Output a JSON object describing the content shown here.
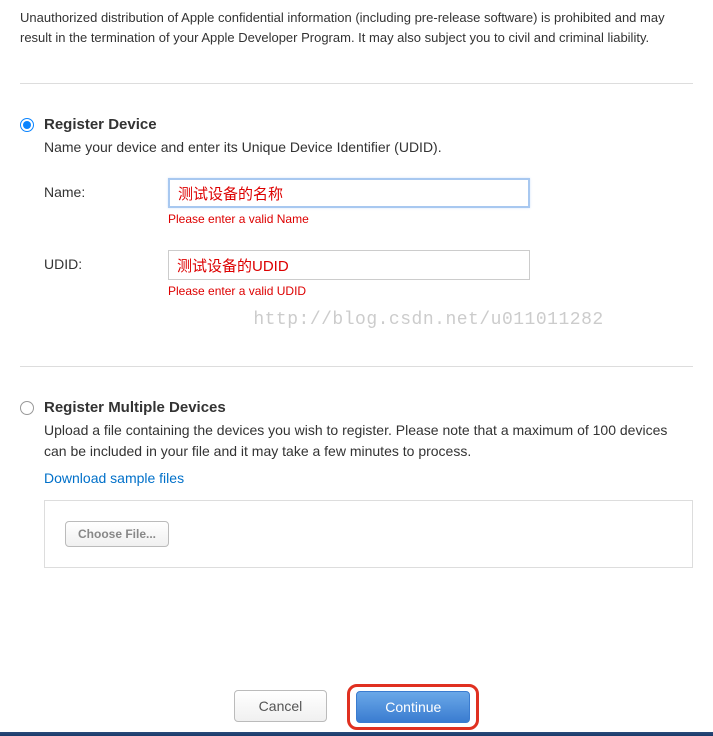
{
  "notice": "Unauthorized distribution of Apple confidential information (including pre-release software) is prohibited and may result in the termination of your Apple Developer Program. It may also subject you to civil and criminal liability.",
  "registerDevice": {
    "title": "Register Device",
    "desc": "Name your device and enter its Unique Device Identifier (UDID).",
    "nameLabel": "Name:",
    "nameValue": "测试设备的名称",
    "nameError": "Please enter a valid Name",
    "udidLabel": "UDID:",
    "udidValue": "测试设备的UDID",
    "udidError": "Please enter a valid UDID"
  },
  "watermark": "http://blog.csdn.net/u011011282",
  "registerMultiple": {
    "title": "Register Multiple Devices",
    "desc": "Upload a file containing the devices you wish to register. Please note that a maximum of 100 devices can be included in your file and it may take a few minutes to process.",
    "downloadLink": "Download sample files",
    "chooseFile": "Choose File..."
  },
  "footer": {
    "cancel": "Cancel",
    "continue": "Continue"
  }
}
